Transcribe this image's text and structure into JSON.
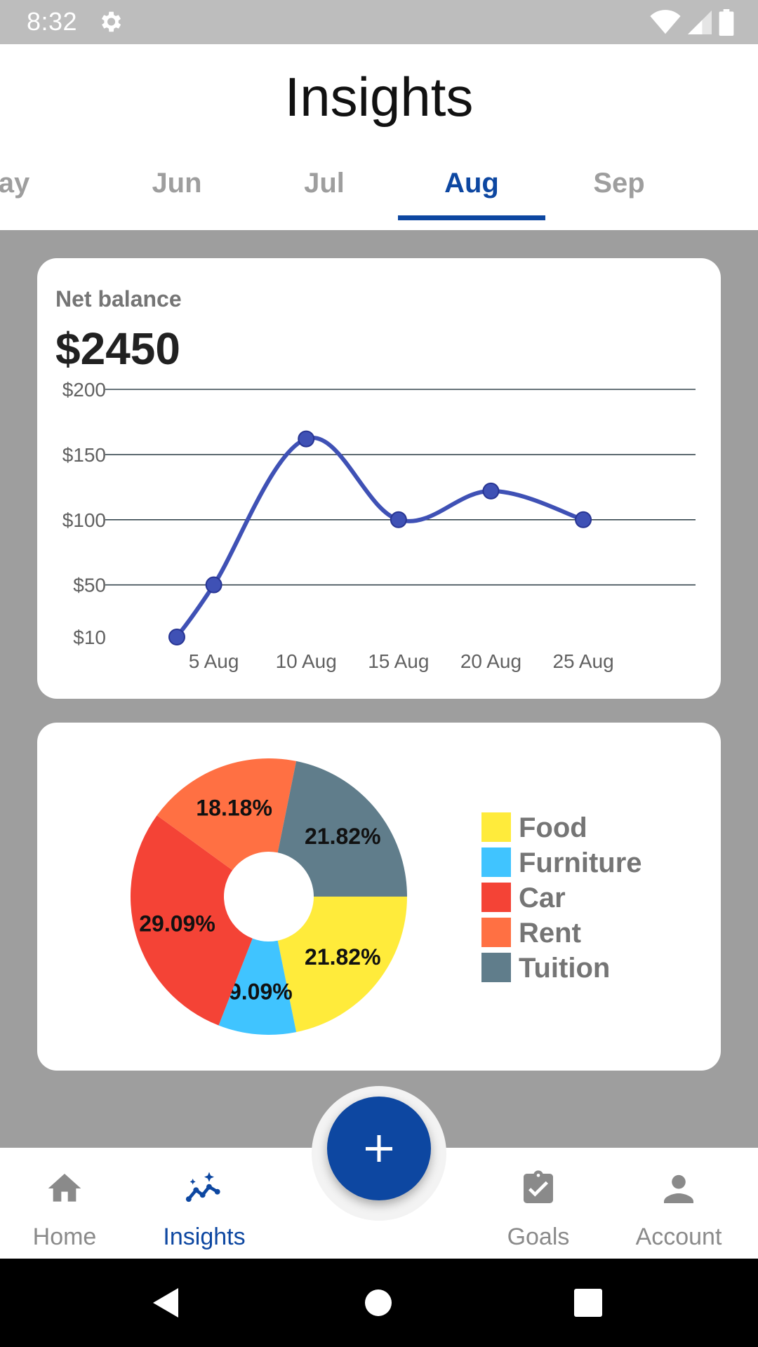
{
  "status_bar": {
    "time": "8:32"
  },
  "header": {
    "title": "Insights",
    "tabs": [
      {
        "label": "ay",
        "active": false
      },
      {
        "label": "Jun",
        "active": false
      },
      {
        "label": "Jul",
        "active": false
      },
      {
        "label": "Aug",
        "active": true
      },
      {
        "label": "Sep",
        "active": false
      }
    ]
  },
  "balance_card": {
    "label": "Net balance",
    "value": "$2450"
  },
  "chart_data": [
    {
      "type": "line",
      "x": [
        3,
        5,
        10,
        15,
        20,
        25
      ],
      "y": [
        10,
        50,
        162,
        100,
        122,
        100
      ],
      "xticks": [
        {
          "x": 5,
          "label": "5 Aug"
        },
        {
          "x": 10,
          "label": "10 Aug"
        },
        {
          "x": 15,
          "label": "15 Aug"
        },
        {
          "x": 20,
          "label": "20 Aug"
        },
        {
          "x": 25,
          "label": "25 Aug"
        }
      ],
      "yticks": [
        {
          "y": 10,
          "label": "$10"
        },
        {
          "y": 50,
          "label": "$50"
        },
        {
          "y": 100,
          "label": "$100"
        },
        {
          "y": 150,
          "label": "$150"
        },
        {
          "y": 200,
          "label": "$200"
        }
      ],
      "gridlines": [
        50,
        100,
        150,
        200
      ],
      "xlim": [
        0,
        31
      ],
      "ylim": [
        10,
        200
      ],
      "line_color": "#3f51b5",
      "grid": true
    },
    {
      "type": "pie",
      "donut": true,
      "legend_position": "right",
      "slices": [
        {
          "label": "Food",
          "value": 21.82,
          "value_label": "21.82%",
          "color": "#ffeb3b"
        },
        {
          "label": "Furniture",
          "value": 9.09,
          "value_label": "9.09%",
          "color": "#40c4ff"
        },
        {
          "label": "Car",
          "value": 29.09,
          "value_label": "29.09%",
          "color": "#f44336"
        },
        {
          "label": "Rent",
          "value": 18.18,
          "value_label": "18.18%",
          "color": "#ff7043"
        },
        {
          "label": "Tuition",
          "value": 21.82,
          "value_label": "21.82%",
          "color": "#607d8b"
        }
      ]
    }
  ],
  "bottom_nav": {
    "items": [
      {
        "label": "Home",
        "icon": "home-icon",
        "active": false
      },
      {
        "label": "Insights",
        "icon": "insights-icon",
        "active": true
      },
      {
        "label": "Goals",
        "icon": "goals-icon",
        "active": false
      },
      {
        "label": "Account",
        "icon": "account-icon",
        "active": false
      }
    ],
    "fab_icon": "plus-icon"
  },
  "colors": {
    "accent": "#0d47a1",
    "inactive": "#9e9e9e",
    "background": "#9e9e9e"
  }
}
